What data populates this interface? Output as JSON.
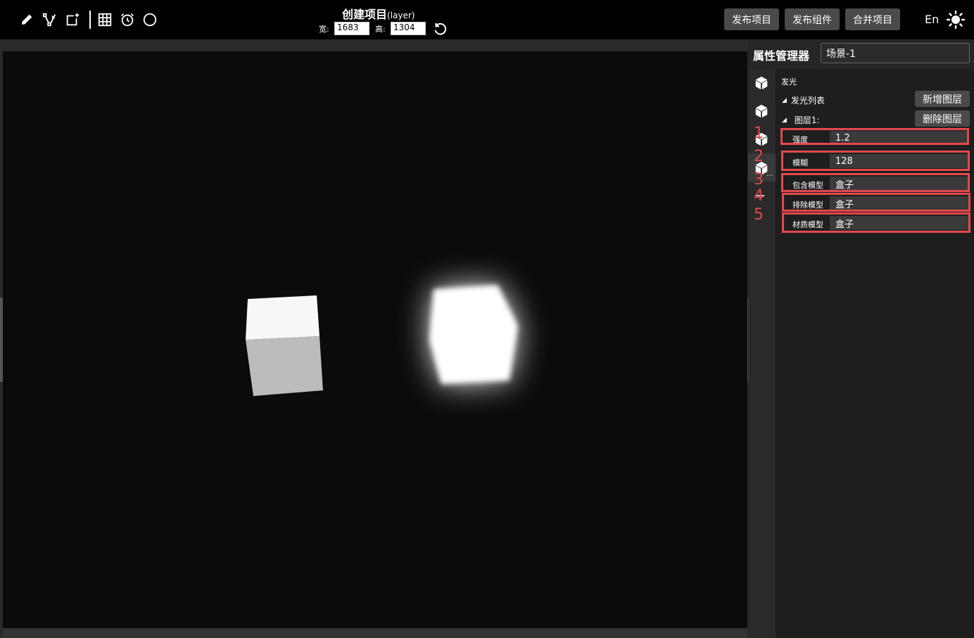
{
  "toolbar": {
    "tools": [
      {
        "name": "pencil-icon"
      },
      {
        "name": "vector-edit-icon"
      },
      {
        "name": "add-frame-icon"
      },
      {
        "name": "grid-icon"
      },
      {
        "name": "alarm-clock-icon"
      },
      {
        "name": "circle-icon"
      }
    ],
    "title": "创建项目",
    "title_sub": "(layer)",
    "width_label": "宽:",
    "width_value": "1683",
    "height_label": "高:",
    "height_value": "1304",
    "publish_project": "发布项目",
    "publish_component": "发布组件",
    "merge_project": "合并项目",
    "language": "En"
  },
  "panel": {
    "title": "属性管理器",
    "scene_name": "场景-1",
    "section": "发光",
    "glow_list_label": "发光列表",
    "add_layer": "新增图层",
    "layer_label": "图层1:",
    "delete_layer": "删除图层",
    "fields": [
      {
        "label": "强度",
        "value": "1.2"
      },
      {
        "label": "模糊",
        "value": "128"
      },
      {
        "label": "包含模型",
        "value": "盒子"
      },
      {
        "label": "排除模型",
        "value": "盒子"
      },
      {
        "label": "材质模型",
        "value": "盒子"
      }
    ],
    "annotations": [
      "1",
      "2",
      "3",
      "4",
      "5"
    ],
    "more": "..."
  },
  "colors": {
    "highlight": "#e5484d",
    "viewport_bg": "#0c0b0c"
  }
}
